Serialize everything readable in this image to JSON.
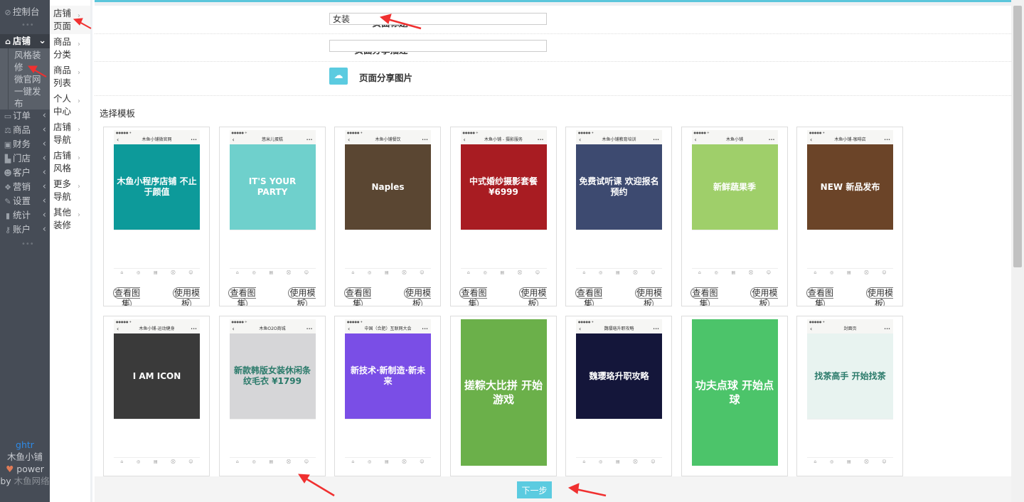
{
  "sidebar": {
    "dashboard": "控制台",
    "shop": "店铺",
    "shop_sub": [
      "风格装修",
      "微官网",
      "一键发布"
    ],
    "items": [
      "订单",
      "商品",
      "财务",
      "门店",
      "客户",
      "营销",
      "设置",
      "统计",
      "账户"
    ],
    "icons": [
      "wallet-icon",
      "scale-icon",
      "money-icon",
      "store-icon",
      "users-icon",
      "gift-icon",
      "wrench-icon",
      "bar-chart-icon",
      "key-icon"
    ],
    "footer": {
      "user": "ghtr",
      "shop_name": "木鱼小铺",
      "power": "power",
      "by": "by",
      "company": "木鱼网络"
    }
  },
  "subnav": {
    "items": [
      "店铺页面",
      "商品分类",
      "商品列表",
      "个人中心",
      "店铺导航",
      "店铺风格",
      "更多导航",
      "其他装修"
    ]
  },
  "form": {
    "title_label": "页面标题",
    "title_value": "女装",
    "desc_label": "页面分享描述",
    "desc_value": "",
    "image_label": "页面分享图片",
    "required_mark": "*"
  },
  "choose_label": "选择模板",
  "card_buttons": {
    "view": "查看图集",
    "use": "使用模板"
  },
  "templates": [
    {
      "title": "木鱼小铺微官网",
      "hero": "木鱼小程序店铺 不止于颜值",
      "color": "#0d9a9a"
    },
    {
      "title": "悠米儿蛋糕",
      "hero": "IT'S YOUR PARTY",
      "color": "#6fd0cc"
    },
    {
      "title": "木鱼小铺餐饮",
      "hero": "Naples",
      "color": "#5a4632"
    },
    {
      "title": "木鱼小铺 - 摄影服务",
      "hero": "中式婚纱摄影套餐 ¥6999",
      "color": "#a81c22"
    },
    {
      "title": "木鱼小铺教育培训",
      "hero": "免费试听课 欢迎报名预约",
      "color": "#3d4a70"
    },
    {
      "title": "木鱼小铺",
      "hero": "新鲜蔬果季",
      "color": "#9fcf6a"
    },
    {
      "title": "木鱼小铺-咖啡店",
      "hero": "NEW 新品发布",
      "color": "#6b4428"
    },
    {
      "title": "木鱼小铺-运动健身",
      "hero": "I AM ICON",
      "color": "#3a3a3a"
    },
    {
      "title": "木鱼O2O商城",
      "hero": "新款韩版女装休闲条纹毛衣 ¥1799",
      "color": "#d6d6d8"
    },
    {
      "title": "中国（合肥）互联网大会",
      "hero": "新技术·新制造·新未来",
      "color": "#7a4ee6"
    },
    {
      "title": "",
      "hero": "搓粽大比拼 开始游戏",
      "color": "#6bb04a",
      "full": true
    },
    {
      "title": "魏璎珞升职攻略",
      "hero": "魏璎珞升职攻略",
      "color": "#14163a"
    },
    {
      "title": "",
      "hero": "功夫点球 开始点球",
      "color": "#4cc46a",
      "full": true
    },
    {
      "title": "封面页",
      "hero": "找茶高手 开始找茶",
      "color": "#e8f3f0"
    }
  ],
  "next_button": "下一步"
}
